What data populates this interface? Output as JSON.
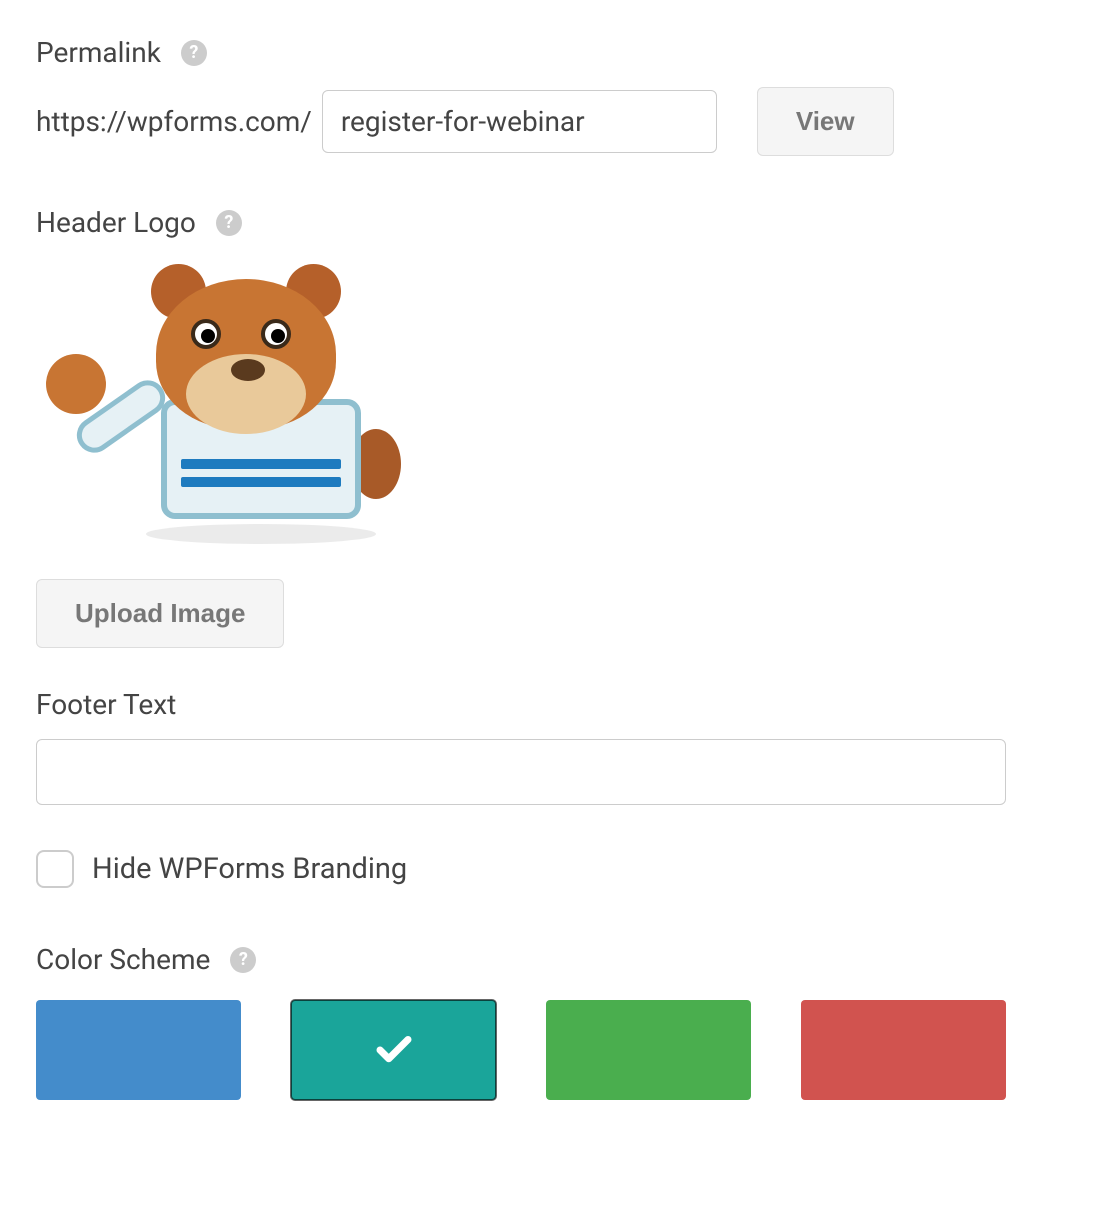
{
  "permalink": {
    "label": "Permalink",
    "base": "https://wpforms.com/",
    "slug": "register-for-webinar",
    "view_button": "View"
  },
  "header_logo": {
    "label": "Header Logo",
    "upload_button": "Upload Image",
    "image_alt": "WPForms mascot bear"
  },
  "footer_text": {
    "label": "Footer Text",
    "value": ""
  },
  "hide_branding": {
    "label": "Hide WPForms Branding",
    "checked": false
  },
  "color_scheme": {
    "label": "Color Scheme",
    "selected_index": 1,
    "swatches": [
      {
        "name": "blue",
        "color": "#448ccb"
      },
      {
        "name": "teal",
        "color": "#1aa59a"
      },
      {
        "name": "green",
        "color": "#4aae4e"
      },
      {
        "name": "red",
        "color": "#d1534f"
      }
    ]
  }
}
